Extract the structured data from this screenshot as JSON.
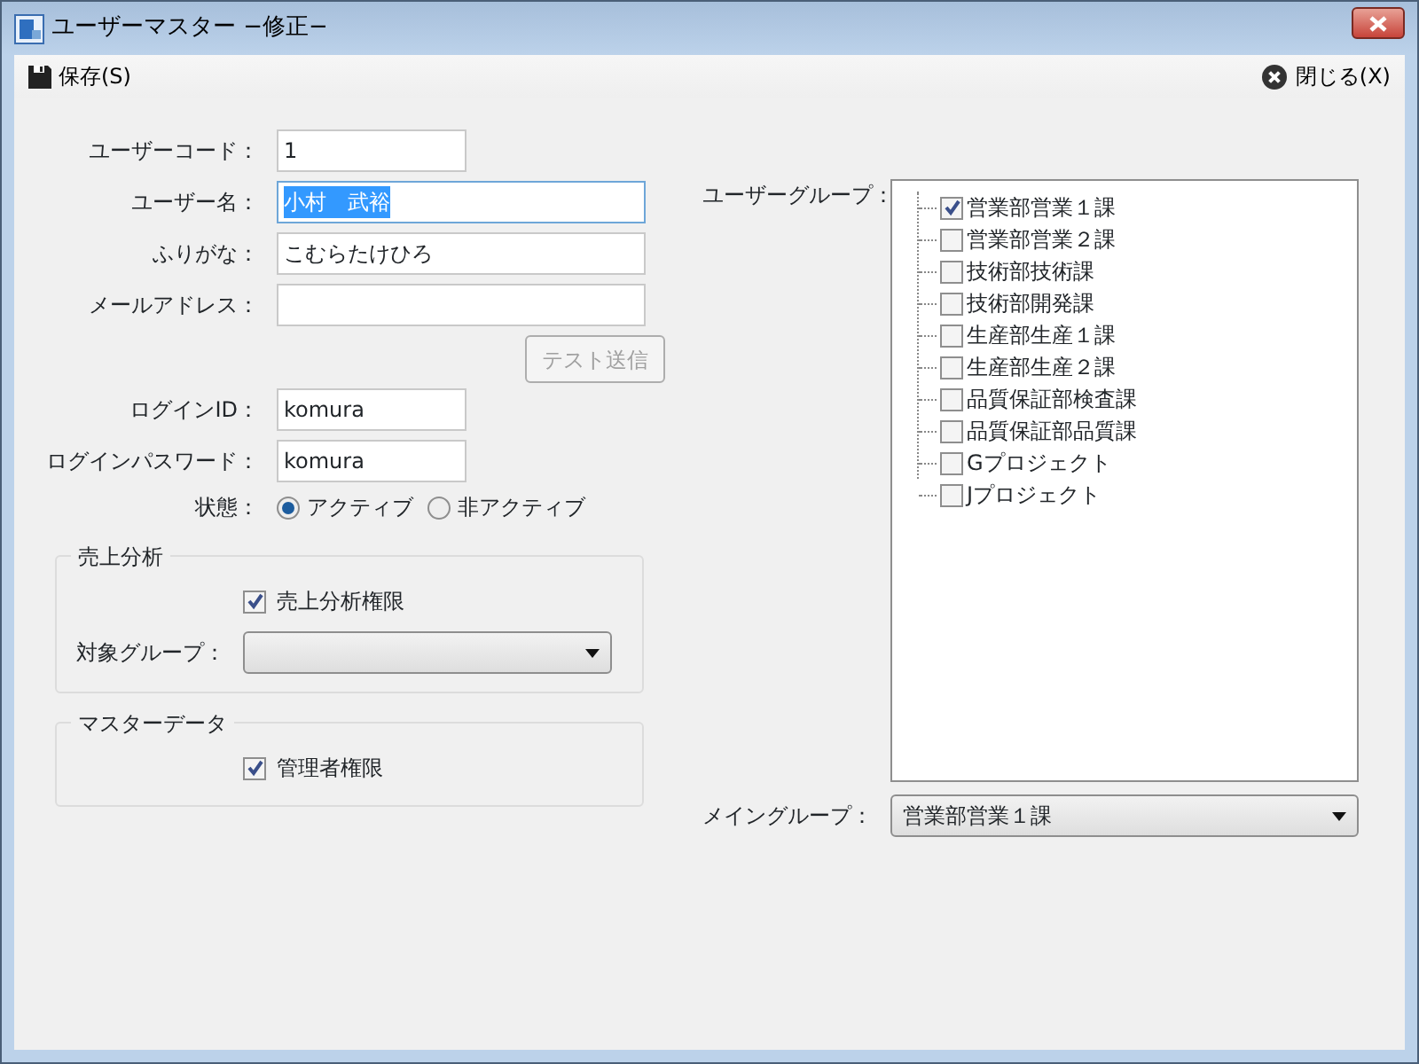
{
  "window": {
    "title": "ユーザーマスター −修正−"
  },
  "toolbar": {
    "save": "保存(S)",
    "close": "閉じる(X)"
  },
  "fields": [
    {
      "kind": "short",
      "label": "ユーザーコード：",
      "value": "1",
      "text_selected": false
    },
    {
      "kind": "long",
      "label": "ユーザー名：",
      "value": "小村　武裕",
      "text_selected": true
    },
    {
      "kind": "long",
      "label": "ふりがな：",
      "value": "こむらたけひろ",
      "text_selected": false
    },
    {
      "kind": "long",
      "label": "メールアドレス：",
      "text_selected": false
    },
    {
      "kind": "button",
      "label": "テスト送信",
      "disabled": true
    },
    {
      "kind": "short",
      "label": "ログインID：",
      "value": "komura",
      "text_selected": false
    },
    {
      "kind": "short",
      "label": "ログインパスワード：",
      "value": "komura",
      "text_selected": false
    }
  ],
  "status": {
    "label": "状態：",
    "options": [
      {
        "label": "アクティブ",
        "selected": true
      },
      {
        "label": "非アクティブ",
        "selected": false
      }
    ]
  },
  "sales_analysis": {
    "title": "売上分析",
    "permission": {
      "label": "売上分析権限",
      "checked": true
    },
    "target_group": {
      "label": "対象グループ："
    }
  },
  "master_data": {
    "title": "マスターデータ",
    "permission": {
      "label": "管理者権限",
      "checked": true
    }
  },
  "user_groups": {
    "label": "ユーザーグループ：",
    "items": [
      {
        "label": "営業部営業１課",
        "checked": true
      },
      {
        "label": "営業部営業２課",
        "checked": false
      },
      {
        "label": "技術部技術課",
        "checked": false
      },
      {
        "label": "技術部開発課",
        "checked": false
      },
      {
        "label": "生産部生産１課",
        "checked": false
      },
      {
        "label": "生産部生産２課",
        "checked": false
      },
      {
        "label": "品質保証部検査課",
        "checked": false
      },
      {
        "label": "品質保証部品質課",
        "checked": false
      },
      {
        "label": "Gプロジェクト",
        "checked": false
      },
      {
        "label": "Jプロジェクト",
        "checked": false
      }
    ]
  },
  "main_group": {
    "label": "メイングループ：",
    "value": "営業部営業１課"
  }
}
